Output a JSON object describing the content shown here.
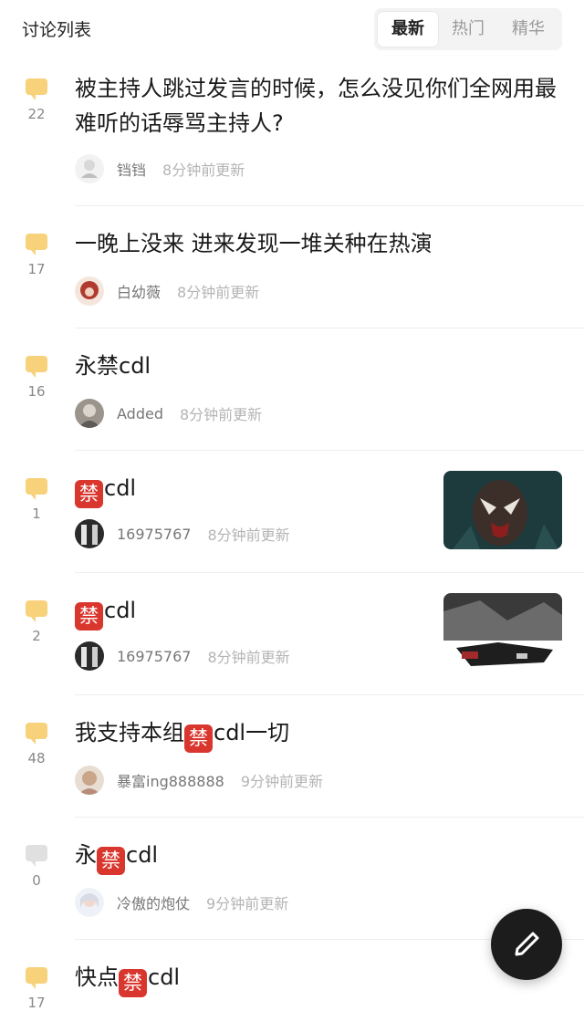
{
  "header": {
    "title": "讨论列表",
    "tabs": [
      "最新",
      "热门",
      "精华"
    ],
    "active_tab": "最新"
  },
  "colors": {
    "bubble_active": "#f7d27a",
    "bubble_inactive": "#e0e0e0",
    "ban_badge": "#d9362e",
    "fab": "#1c1c1c"
  },
  "ban_badge_text": "禁",
  "posts": [
    {
      "count": "22",
      "title": "被主持人跳过发言的时候，怎么没见你们全网用最难听的话辱骂主持人?",
      "author": "铛铛",
      "time": "8分钟前更新"
    },
    {
      "count": "17",
      "title": "一晚上没来 进来发现一堆关种在热演",
      "author": "白幼薇",
      "time": "8分钟前更新"
    },
    {
      "count": "16",
      "title": "永禁cdl",
      "author": "Added",
      "time": "8分钟前更新"
    },
    {
      "count": "1",
      "title_suffix": "cdl",
      "author": "16975767",
      "time": "8分钟前更新"
    },
    {
      "count": "2",
      "title_suffix": "cdl",
      "author": "16975767",
      "time": "8分钟前更新"
    },
    {
      "count": "48",
      "title_prefix": "我支持本组",
      "title_suffix": "cdl一切",
      "author": "暴富ing888888",
      "time": "9分钟前更新"
    },
    {
      "count": "0",
      "title_prefix": "永",
      "title_suffix": "cdl",
      "author": "冷傲的炮仗",
      "time": "9分钟前更新"
    },
    {
      "count": "17",
      "title_prefix": "快点",
      "title_suffix": "cdl"
    }
  ],
  "icons": {
    "comment": "comment-bubble-icon",
    "compose": "pencil-icon"
  }
}
